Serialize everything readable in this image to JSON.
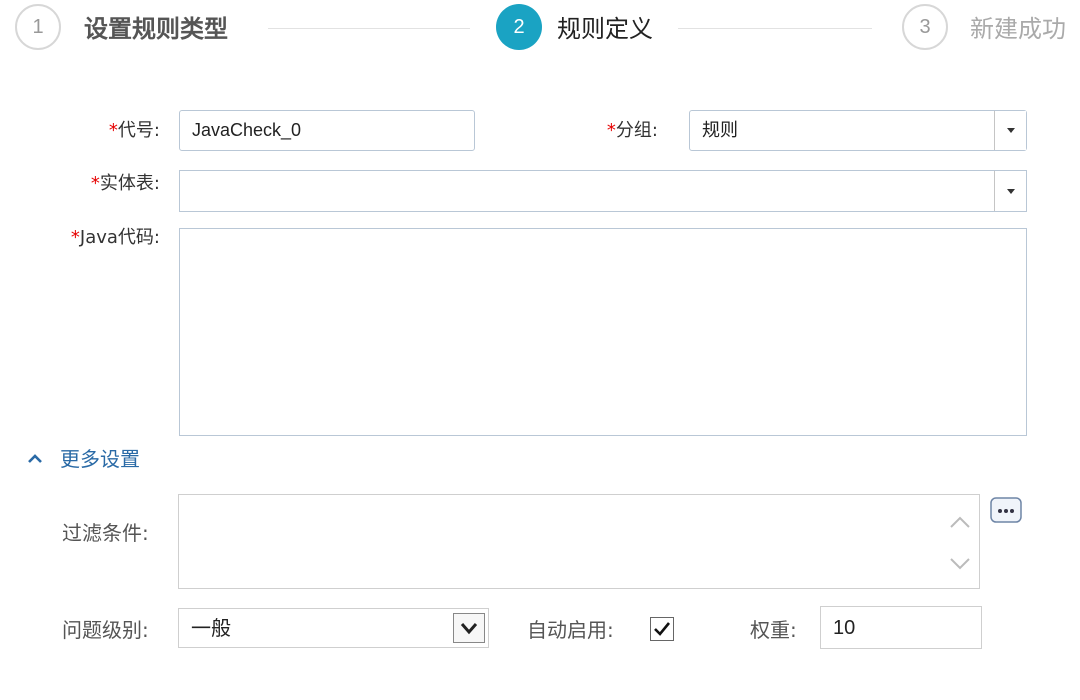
{
  "steps": [
    {
      "number": "1",
      "label": "设置规则类型",
      "state": "done"
    },
    {
      "number": "2",
      "label": "规则定义",
      "state": "active"
    },
    {
      "number": "3",
      "label": "新建成功",
      "state": "todo"
    }
  ],
  "form": {
    "code": {
      "label": "代号:",
      "value": "JavaCheck_0",
      "required": "*"
    },
    "group": {
      "label": "分组:",
      "value": "规则",
      "required": "*"
    },
    "entity": {
      "label": "实体表:",
      "value": "",
      "required": "*"
    },
    "java_code": {
      "label": "Java代码:",
      "value": "",
      "required": "*"
    }
  },
  "more_settings": {
    "toggle_label": "更多设置",
    "filter": {
      "label": "过滤条件:",
      "value": ""
    },
    "level": {
      "label": "问题级别:",
      "value": "一般"
    },
    "auto_enable": {
      "label": "自动启用:",
      "checked": true
    },
    "weight": {
      "label": "权重:",
      "value": "10"
    }
  },
  "colors": {
    "accent": "#1aa3c3",
    "required": "#e60000",
    "link": "#2a6aa6"
  }
}
